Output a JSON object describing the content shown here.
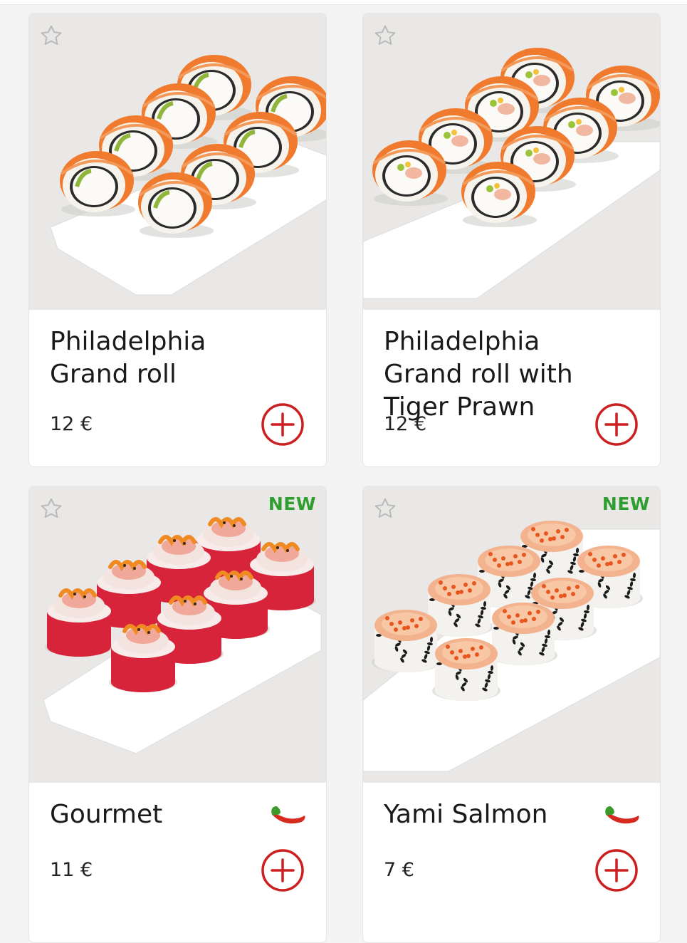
{
  "products": [
    {
      "title": "Philadelphia Grand roll",
      "price": "12 €",
      "badge": "",
      "spicy": false,
      "image": "salmon-rolls",
      "favorite_icon": "star-outline-icon",
      "add_icon": "plus-circle-icon"
    },
    {
      "title": "Philadelphia Grand roll with Tiger Prawn",
      "price": "12 €",
      "badge": "",
      "spicy": false,
      "image": "salmon-prawn-rolls",
      "favorite_icon": "star-outline-icon",
      "add_icon": "plus-circle-icon"
    },
    {
      "title": "Gourmet",
      "price": "11 €",
      "badge": "NEW",
      "spicy": true,
      "image": "red-tobiko-rolls",
      "favorite_icon": "star-outline-icon",
      "add_icon": "plus-circle-icon"
    },
    {
      "title": "Yami Salmon",
      "price": "7 €",
      "badge": "NEW",
      "spicy": true,
      "image": "sesame-baked-rolls",
      "favorite_icon": "star-outline-icon",
      "add_icon": "plus-circle-icon"
    }
  ],
  "colors": {
    "accent": "#cc1f1f",
    "new_badge": "#2e9e2e",
    "salmon": "#f07a2e",
    "tobiko": "#d8243a"
  }
}
